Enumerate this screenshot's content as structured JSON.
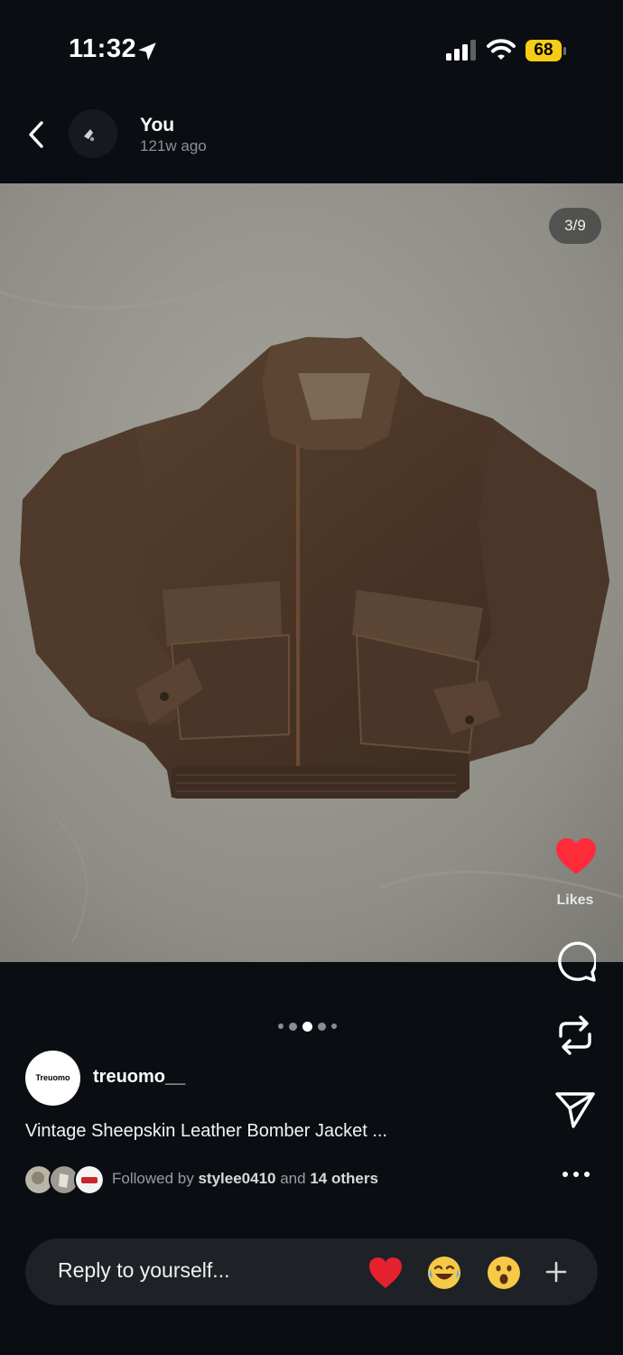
{
  "status_bar": {
    "time": "11:32",
    "battery": "68",
    "icons": [
      "location-arrow-icon",
      "cellular-signal-icon",
      "wifi-icon",
      "battery-icon"
    ]
  },
  "header": {
    "user_name": "You",
    "post_age": "121w ago"
  },
  "media": {
    "page_counter": "3/9",
    "current_index": 3,
    "total": 9,
    "subject": "brown leather bomber jacket on concrete floor"
  },
  "actions": {
    "likes_label": "Likes",
    "liked": true,
    "icons": [
      "heart-icon",
      "comment-icon",
      "repost-icon",
      "share-icon",
      "more-icon"
    ]
  },
  "post": {
    "author_avatar_text": "Treuomo",
    "author_name": "treuomo__",
    "caption": "Vintage Sheepskin Leather Bomber Jacket ...",
    "followed_by_prefix": "Followed by",
    "followed_by_user": "stylee0410",
    "followed_by_and": "and",
    "followed_by_others": "14 others"
  },
  "reply": {
    "placeholder": "Reply to yourself...",
    "quick_reactions": [
      "heart-emoji",
      "laughing-emoji",
      "surprised-emoji"
    ]
  },
  "colors": {
    "background": "#0a0e13",
    "like_red": "#ff2a3a",
    "battery_yellow": "#f5cd17",
    "reply_bar": "#1e2126"
  }
}
